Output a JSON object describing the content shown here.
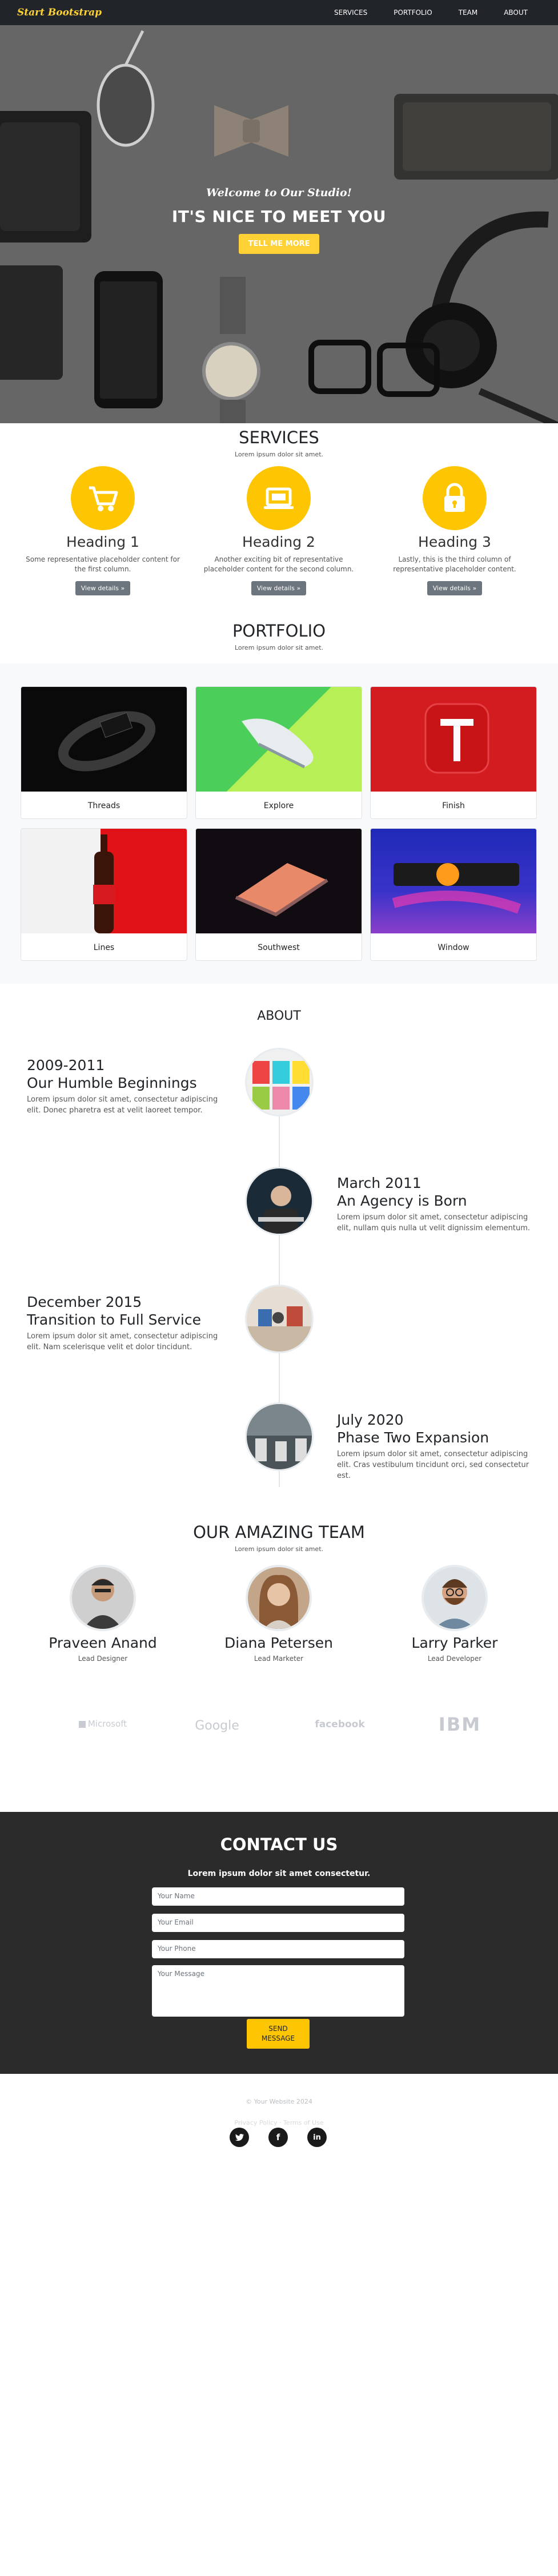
{
  "nav": {
    "brand": "Start Bootstrap",
    "links": [
      "SERVICES",
      "PORTFOLIO",
      "TEAM",
      "ABOUT"
    ]
  },
  "hero": {
    "subtitle": "Welcome to Our Studio!",
    "title": "IT'S NICE TO MEET YOU",
    "button": "TELL ME MORE"
  },
  "services": {
    "title": "SERVICES",
    "subtitle": "Lorem ipsum dolor sit amet.",
    "items": [
      {
        "icon": "cart-icon",
        "heading": "Heading 1",
        "text": "Some representative placeholder content for the first column.",
        "button": "View details »"
      },
      {
        "icon": "laptop-icon",
        "heading": "Heading 2",
        "text": "Another exciting bit of representative placeholder content for the second column.",
        "button": "View details »"
      },
      {
        "icon": "lock-icon",
        "heading": "Heading 3",
        "text": "Lastly, this is the third column of representative placeholder content.",
        "button": "View details »"
      }
    ],
    "accent": "#fec503"
  },
  "portfolio": {
    "title": "PORTFOLIO",
    "subtitle": "Lorem ipsum dolor sit amet.",
    "items": [
      {
        "caption": "Threads"
      },
      {
        "caption": "Explore"
      },
      {
        "caption": "Finish"
      },
      {
        "caption": "Lines"
      },
      {
        "caption": "Southwest"
      },
      {
        "caption": "Window"
      }
    ]
  },
  "about": {
    "title": "ABOUT",
    "events": [
      {
        "date": "2009-2011",
        "heading": "Our Humble Beginnings",
        "body": "Lorem ipsum dolor sit amet, consectetur adipiscing elit. Donec pharetra est at velit laoreet tempor."
      },
      {
        "date": "March 2011",
        "heading": "An Agency is Born",
        "body": "Lorem ipsum dolor sit amet, consectetur adipiscing elit, nullam quis nulla ut velit dignissim elementum."
      },
      {
        "date": "December 2015",
        "heading": "Transition to Full Service",
        "body": "Lorem ipsum dolor sit amet, consectetur adipiscing elit. Nam scelerisque velit et dolor tincidunt."
      },
      {
        "date": "July 2020",
        "heading": "Phase Two Expansion",
        "body": "Lorem ipsum dolor sit amet, consectetur adipiscing elit. Cras vestibulum tincidunt orci, sed consectetur est."
      }
    ]
  },
  "team": {
    "title": "OUR AMAZING TEAM",
    "subtitle": "Lorem ipsum dolor sit amet.",
    "members": [
      {
        "name": "Praveen Anand",
        "role": "Lead Designer"
      },
      {
        "name": "Diana Petersen",
        "role": "Lead Marketer"
      },
      {
        "name": "Larry Parker",
        "role": "Lead Developer"
      }
    ]
  },
  "logos": [
    "Microsoft",
    "Google",
    "facebook",
    "IBM"
  ],
  "contact": {
    "title": "CONTACT US",
    "subtitle": "Lorem ipsum dolor sit amet consectetur.",
    "name_placeholder": "Your Name",
    "email_placeholder": "Your Email",
    "phone_placeholder": "Your Phone",
    "message_placeholder": "Your Message",
    "button_line1": "SEND",
    "button_line2": "MESSAGE"
  },
  "footer": {
    "copyright": "© Your Website 2024",
    "links_text": "Privacy Policy · Terms of Use",
    "social": [
      {
        "icon": "twitter-icon",
        "glyph": "t"
      },
      {
        "icon": "facebook-icon",
        "glyph": "f"
      },
      {
        "icon": "linkedin-icon",
        "glyph": "in"
      }
    ]
  },
  "colors": {
    "nav": "#212529",
    "accent": "#fec503",
    "contact_bg": "#2b2b2b"
  }
}
